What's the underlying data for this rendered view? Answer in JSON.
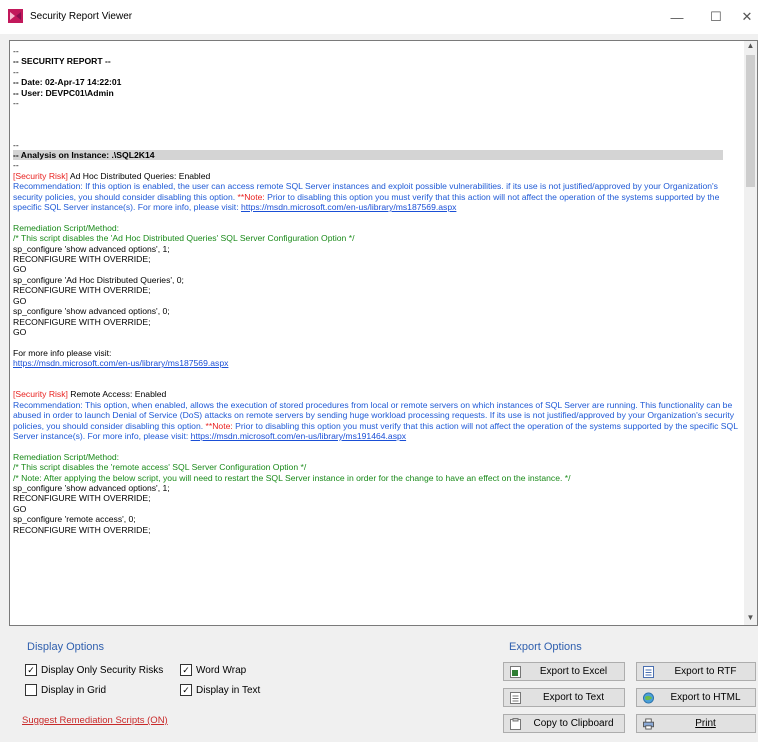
{
  "window": {
    "title": "Security Report Viewer",
    "minimize": "—",
    "maximize": "☐",
    "close": "✕"
  },
  "report": {
    "lines": [
      {
        "t": "--",
        "c": ""
      },
      {
        "t": "-- SECURITY REPORT --",
        "c": "bold"
      },
      {
        "t": "--",
        "c": ""
      },
      {
        "t": "-- Date: 02-Apr-17 14:22:01",
        "c": "bold"
      },
      {
        "t": "-- User: DEVPC01\\Admin",
        "c": "bold"
      },
      {
        "t": "--",
        "c": ""
      },
      {
        "t": "",
        "c": ""
      },
      {
        "t": "",
        "c": ""
      },
      {
        "t": "",
        "c": ""
      },
      {
        "t": "--",
        "c": ""
      },
      {
        "t": "-- Analysis on Instance: .\\SQL2K14",
        "c": "hl"
      },
      {
        "t": "--",
        "c": ""
      }
    ],
    "risk1": {
      "tag": "[Security Risk]",
      "text": " Ad Hoc Distributed Queries: Enabled",
      "rec_before": "Recommendation: If this option is enabled, the user can access remote SQL Server instances and exploit possible vulnerabilities. if its use is not justified/approved by your Organization's security policies, you should consider disabling this option. ",
      "note": "**Note:",
      "rec_after": " Prior to disabling this option you must verify that this action will not affect the operation of the systems supported by the specific SQL Server instance(s). For more info, please visit: ",
      "link": "https://msdn.microsoft.com/en-us/library/ms187569.aspx",
      "rem_title": "Remediation Script/Method:",
      "rem_comment": "/* This script disables the 'Ad Hoc Distributed Queries' SQL Server Configuration Option */",
      "script": [
        "sp_configure 'show advanced options', 1;",
        "RECONFIGURE WITH OVERRIDE;",
        "GO",
        "sp_configure 'Ad Hoc Distributed Queries', 0;",
        "RECONFIGURE WITH OVERRIDE;",
        "GO",
        "sp_configure 'show advanced options', 0;",
        "RECONFIGURE WITH OVERRIDE;",
        "GO"
      ],
      "more_info": "For more info please visit:",
      "more_link": "https://msdn.microsoft.com/en-us/library/ms187569.aspx"
    },
    "risk2": {
      "tag": "[Security Risk]",
      "text": " Remote Access: Enabled",
      "rec_before": "Recommendation: This option, when enabled, allows the execution of stored procedures from local or remote servers on which instances of SQL Server are running. This functionality can be abused in order to launch Denial of Service (DoS) attacks on remote servers by sending huge workload processing requests. If its use is not justified/approved by your Organization's security policies, you should consider disabling this option. ",
      "note": "**Note:",
      "rec_after": " Prior to disabling this option you must verify that this action will not affect the operation of the systems supported by the specific SQL Server instance(s). For more info, please visit: ",
      "link": "https://msdn.microsoft.com/en-us/library/ms191464.aspx",
      "rem_title": "Remediation Script/Method:",
      "rem_comment": "/* This script disables the 'remote access' SQL Server Configuration Option */",
      "rem_comment2": "/* Note: After applying the below script, you will need to restart the SQL Server instance in order for the change to have an effect on the instance. */",
      "script": [
        "sp_configure 'show advanced options', 1;",
        "RECONFIGURE WITH OVERRIDE;",
        "GO",
        "sp_configure 'remote access', 0;",
        "RECONFIGURE WITH OVERRIDE;"
      ]
    }
  },
  "display_options": {
    "title": "Display Options",
    "only_risks": "Display Only Security Risks",
    "word_wrap": "Word Wrap",
    "in_grid": "Display in Grid",
    "in_text": "Display in Text",
    "only_risks_checked": true,
    "word_wrap_checked": true,
    "in_grid_checked": false,
    "in_text_checked": true,
    "suggest": "Suggest Remediation Scripts (ON)"
  },
  "export_options": {
    "title": "Export Options",
    "excel": "Export to Excel",
    "rtf": "Export to RTF",
    "text": "Export to Text",
    "html": "Export to HTML",
    "clipboard": "Copy to Clipboard",
    "print": "Print"
  },
  "colors": {
    "risk": "#e8211f",
    "recommendation": "#1f5ad6",
    "remediation": "#1a8a1a",
    "group_label": "#2f5fae"
  }
}
